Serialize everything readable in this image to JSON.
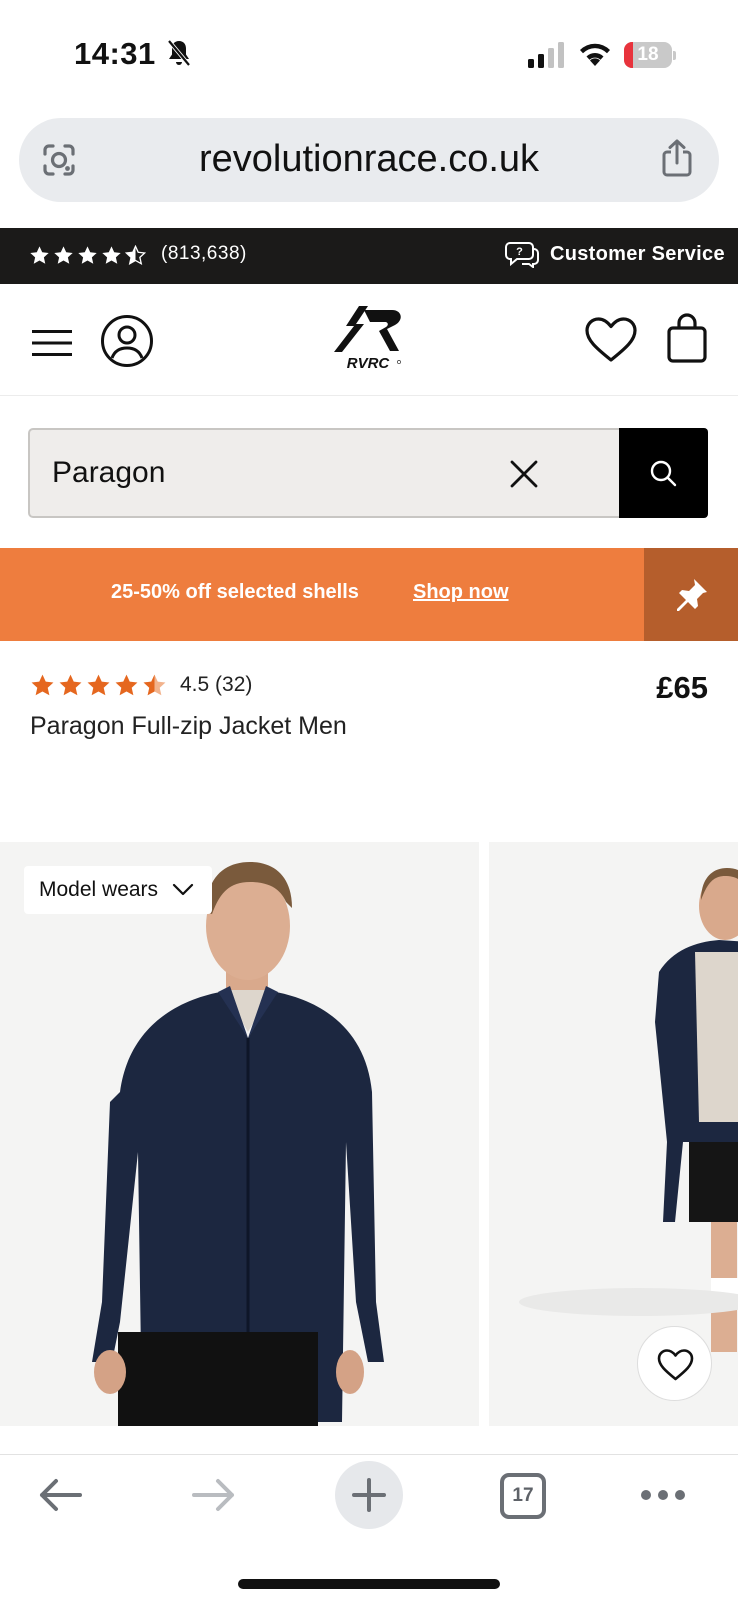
{
  "status_bar": {
    "time": "14:31",
    "battery": "18",
    "battery_level": 0.18
  },
  "browser": {
    "url": "revolutionrace.co.uk",
    "tab_count": "17"
  },
  "top_bar": {
    "review_count": "(813,638)",
    "customer_service": "Customer Service",
    "rating_stars": 4.5
  },
  "search": {
    "value": "Paragon"
  },
  "promo": {
    "text": "25-50% off selected shells",
    "link": "Shop now",
    "background": "#ee7d3e",
    "pin_background": "#b55e2c"
  },
  "product": {
    "rating": "4.5 (32)",
    "name": "Paragon Full-zip Jacket Men",
    "price": "£65",
    "star_color": "#e5671f"
  },
  "gallery": {
    "model_chip": "Model wears"
  }
}
